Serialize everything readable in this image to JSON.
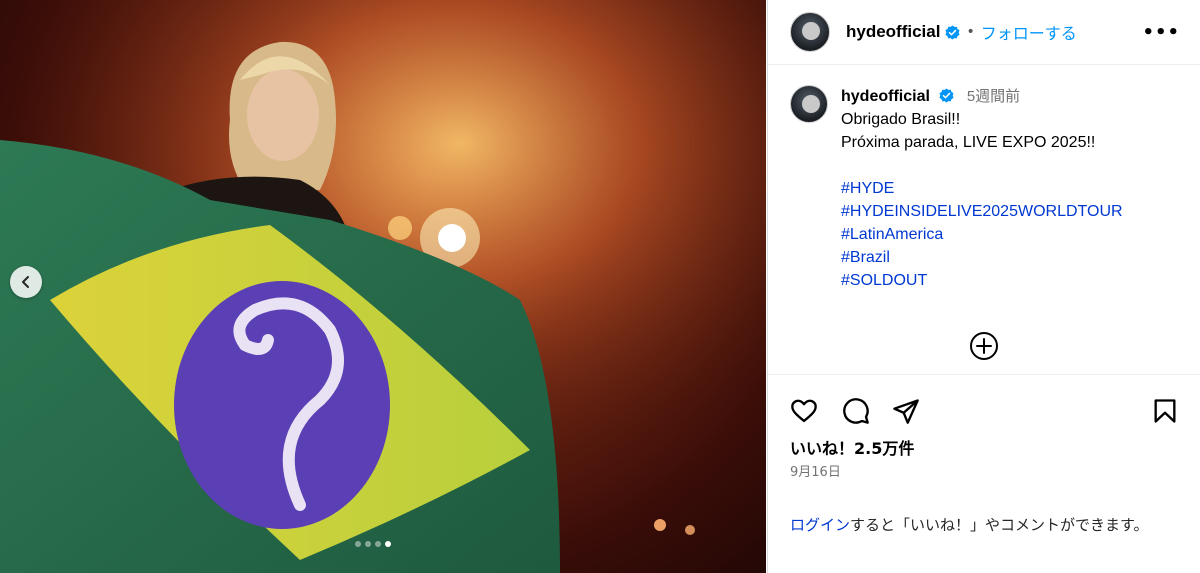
{
  "post": {
    "carousel": {
      "slides": 4,
      "active_slide": 4
    }
  },
  "header": {
    "username": "hydeofficial",
    "separator": "•",
    "follow_label": "フォローする",
    "more_label": "•••"
  },
  "caption": {
    "username": "hydeofficial",
    "time_ago": "5週間前",
    "lines": [
      "Obrigado Brasil!!",
      "Próxima parada, LIVE EXPO 2025!!"
    ],
    "hashtags": [
      "#HYDE",
      "#HYDEINSIDELIVE2025WORLDTOUR",
      "#LatinAmerica",
      "#Brazil",
      "#SOLDOUT"
    ]
  },
  "engagement": {
    "likes_text": "いいね！2.5万件",
    "date": "9月16日"
  },
  "login_prompt": {
    "link": "ログイン",
    "text": "すると「いいね！」やコメントができます。"
  },
  "colors": {
    "accent": "#0095f6",
    "hashtag": "#0038d1",
    "verified": "#0095f6"
  }
}
